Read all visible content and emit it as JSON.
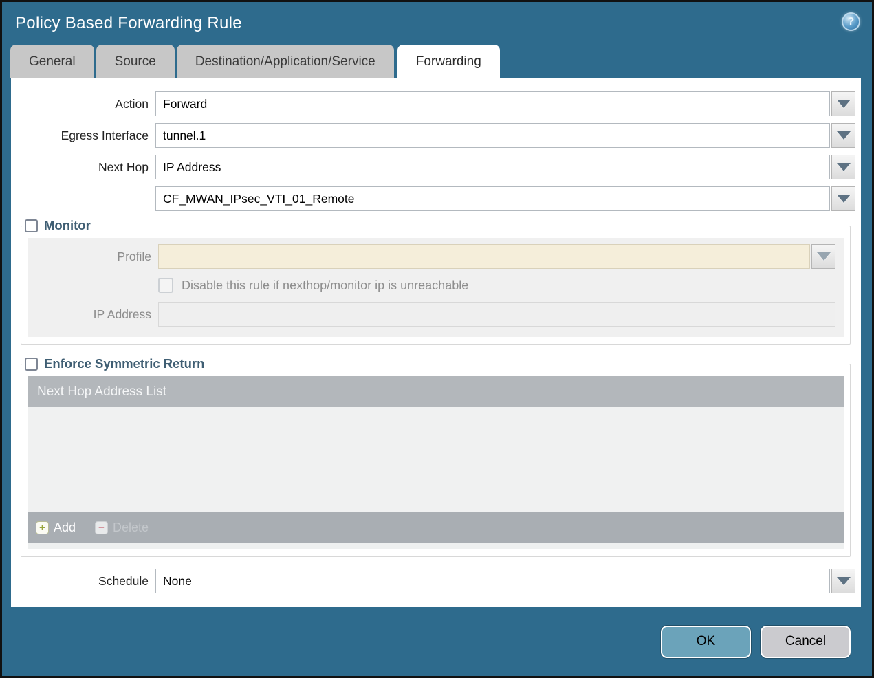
{
  "window": {
    "title": "Policy Based Forwarding Rule",
    "help_glyph": "?"
  },
  "tabs": [
    {
      "label": "General",
      "active": false
    },
    {
      "label": "Source",
      "active": false
    },
    {
      "label": "Destination/Application/Service",
      "active": false
    },
    {
      "label": "Forwarding",
      "active": true
    }
  ],
  "form": {
    "action": {
      "label": "Action",
      "value": "Forward"
    },
    "egress_interface": {
      "label": "Egress Interface",
      "value": "tunnel.1"
    },
    "next_hop": {
      "label": "Next Hop",
      "value": "IP Address"
    },
    "next_hop_address": {
      "value": "CF_MWAN_IPsec_VTI_01_Remote"
    },
    "schedule": {
      "label": "Schedule",
      "value": "None"
    }
  },
  "monitor": {
    "title": "Monitor",
    "checked": false,
    "profile": {
      "label": "Profile",
      "value": ""
    },
    "disable_rule": {
      "label": "Disable this rule if nexthop/monitor ip is unreachable",
      "checked": false
    },
    "ip_address": {
      "label": "IP Address",
      "value": ""
    }
  },
  "symmetric_return": {
    "title": "Enforce Symmetric Return",
    "checked": false,
    "table": {
      "header": "Next Hop Address List",
      "rows": []
    },
    "toolbar": {
      "add_label": "Add",
      "add_glyph": "+",
      "delete_label": "Delete",
      "delete_glyph": "−",
      "delete_enabled": false
    }
  },
  "footer": {
    "ok_label": "OK",
    "cancel_label": "Cancel"
  },
  "colors": {
    "titlebar": "#2e6b8d",
    "tab_inactive": "#c7c7c7",
    "legend_text": "#3f5e73",
    "table_header": "#b3b7bb",
    "toolbar": "#a9aeb3",
    "disabled_panel": "#f0f0f0",
    "profile_field": "#f5eeda",
    "ok_button": "#6ba3ba",
    "cancel_button": "#cbcbcf"
  }
}
